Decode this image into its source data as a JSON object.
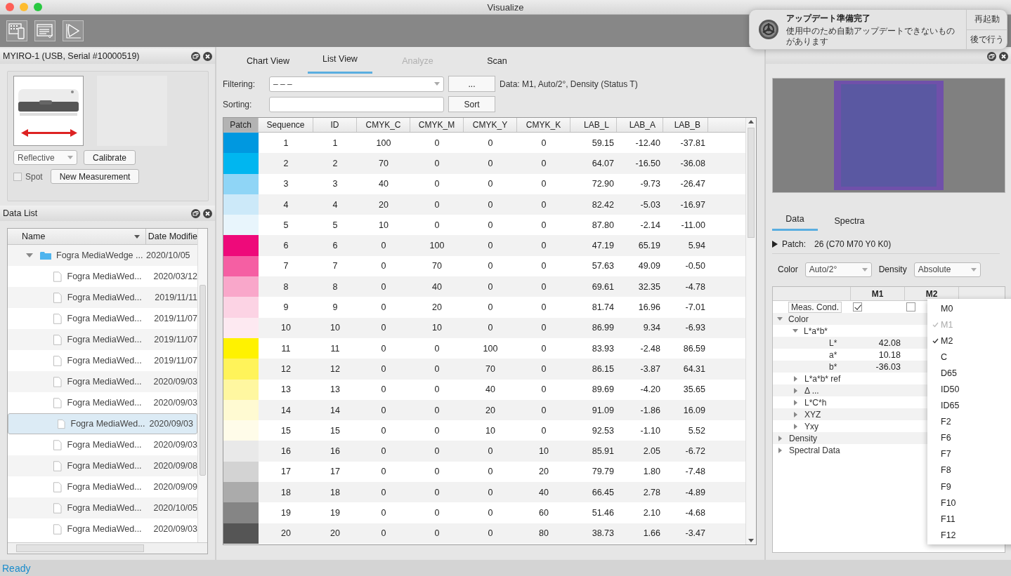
{
  "window": {
    "title": "Visualize"
  },
  "device_panel": {
    "title": "MYIRO-1 (USB, Serial #10000519)",
    "mode": "Reflective",
    "calibrate": "Calibrate",
    "spot": {
      "label": "Spot",
      "checked": false
    },
    "new_measurement": "New Measurement"
  },
  "data_list": {
    "title": "Data List",
    "columns": [
      "Name",
      "Date Modifie"
    ],
    "folder": {
      "name": "Fogra MediaWedge ...",
      "date": "2020/10/05",
      "expanded": true,
      "children": [
        {
          "name": "Fogra MediaWed...",
          "date": "2020/03/12",
          "selected": false
        },
        {
          "name": "Fogra MediaWed...",
          "date": "2019/11/11",
          "selected": false
        },
        {
          "name": "Fogra MediaWed...",
          "date": "2019/11/07",
          "selected": false
        },
        {
          "name": "Fogra MediaWed...",
          "date": "2019/11/07",
          "selected": false
        },
        {
          "name": "Fogra MediaWed...",
          "date": "2019/11/07",
          "selected": false
        },
        {
          "name": "Fogra MediaWed...",
          "date": "2020/09/03",
          "selected": false
        },
        {
          "name": "Fogra MediaWed...",
          "date": "2020/09/03",
          "selected": false
        },
        {
          "name": "Fogra MediaWed...",
          "date": "2020/09/03",
          "selected": true
        },
        {
          "name": "Fogra MediaWed...",
          "date": "2020/09/03",
          "selected": false
        },
        {
          "name": "Fogra MediaWed...",
          "date": "2020/09/08",
          "selected": false
        },
        {
          "name": "Fogra MediaWed...",
          "date": "2020/09/09",
          "selected": false
        },
        {
          "name": "Fogra MediaWed...",
          "date": "2020/10/05",
          "selected": false
        },
        {
          "name": "Fogra MediaWed...",
          "date": "2020/09/03",
          "selected": false
        }
      ]
    }
  },
  "view_tabs": [
    {
      "label": "Chart View",
      "selected": false,
      "disabled": false
    },
    {
      "label": "List View",
      "selected": true,
      "disabled": false
    },
    {
      "label": "Analyze",
      "selected": false,
      "disabled": true
    },
    {
      "label": "Scan",
      "selected": false,
      "disabled": false
    }
  ],
  "filtering": {
    "label": "Filtering:",
    "value": "– – –",
    "button": "...",
    "info": "Data: M1, Auto/2°, Density (Status T)"
  },
  "sorting": {
    "label": "Sorting:",
    "button": "Sort"
  },
  "table": {
    "columns": [
      "Patch",
      "Sequence",
      "ID",
      "CMYK_C",
      "CMYK_M",
      "CMYK_Y",
      "CMYK_K",
      "LAB_L",
      "LAB_A",
      "LAB_B"
    ],
    "rows": [
      {
        "color": "#0098e0",
        "cells": [
          "",
          "1",
          "1",
          "100",
          "0",
          "0",
          "0",
          "59.15",
          "-12.40",
          "-37.81"
        ]
      },
      {
        "color": "#00b6f0",
        "cells": [
          "",
          "2",
          "2",
          "70",
          "0",
          "0",
          "0",
          "64.07",
          "-16.50",
          "-36.08"
        ]
      },
      {
        "color": "#8fd5f6",
        "cells": [
          "",
          "3",
          "3",
          "40",
          "0",
          "0",
          "0",
          "72.90",
          "-9.73",
          "-26.47"
        ]
      },
      {
        "color": "#cce9f9",
        "cells": [
          "",
          "4",
          "4",
          "20",
          "0",
          "0",
          "0",
          "82.42",
          "-5.03",
          "-16.97"
        ]
      },
      {
        "color": "#e8f5fc",
        "cells": [
          "",
          "5",
          "5",
          "10",
          "0",
          "0",
          "0",
          "87.80",
          "-2.14",
          "-11.00"
        ]
      },
      {
        "color": "#ee0a7a",
        "cells": [
          "",
          "6",
          "6",
          "0",
          "100",
          "0",
          "0",
          "47.19",
          "65.19",
          "5.94"
        ]
      },
      {
        "color": "#f55fa3",
        "cells": [
          "",
          "7",
          "7",
          "0",
          "70",
          "0",
          "0",
          "57.63",
          "49.09",
          "-0.50"
        ]
      },
      {
        "color": "#f9a7ca",
        "cells": [
          "",
          "8",
          "8",
          "0",
          "40",
          "0",
          "0",
          "69.61",
          "32.35",
          "-4.78"
        ]
      },
      {
        "color": "#fcd3e4",
        "cells": [
          "",
          "9",
          "9",
          "0",
          "20",
          "0",
          "0",
          "81.74",
          "16.96",
          "-7.01"
        ]
      },
      {
        "color": "#fde9f1",
        "cells": [
          "",
          "10",
          "10",
          "0",
          "10",
          "0",
          "0",
          "86.99",
          "9.34",
          "-6.93"
        ]
      },
      {
        "color": "#fff200",
        "cells": [
          "",
          "11",
          "11",
          "0",
          "0",
          "100",
          "0",
          "83.93",
          "-2.48",
          "86.59"
        ]
      },
      {
        "color": "#fff35a",
        "cells": [
          "",
          "12",
          "12",
          "0",
          "0",
          "70",
          "0",
          "86.15",
          "-3.87",
          "64.31"
        ]
      },
      {
        "color": "#fff7a0",
        "cells": [
          "",
          "13",
          "13",
          "0",
          "0",
          "40",
          "0",
          "89.69",
          "-4.20",
          "35.65"
        ]
      },
      {
        "color": "#fffad2",
        "cells": [
          "",
          "14",
          "14",
          "0",
          "0",
          "20",
          "0",
          "91.09",
          "-1.86",
          "16.09"
        ]
      },
      {
        "color": "#fffce9",
        "cells": [
          "",
          "15",
          "15",
          "0",
          "0",
          "10",
          "0",
          "92.53",
          "-1.10",
          "5.52"
        ]
      },
      {
        "color": "#e9e9e9",
        "cells": [
          "",
          "16",
          "16",
          "0",
          "0",
          "0",
          "10",
          "85.91",
          "2.05",
          "-6.72"
        ]
      },
      {
        "color": "#d3d3d3",
        "cells": [
          "",
          "17",
          "17",
          "0",
          "0",
          "0",
          "20",
          "79.79",
          "1.80",
          "-7.48"
        ]
      },
      {
        "color": "#ababab",
        "cells": [
          "",
          "18",
          "18",
          "0",
          "0",
          "0",
          "40",
          "66.45",
          "2.78",
          "-4.89"
        ]
      },
      {
        "color": "#858585",
        "cells": [
          "",
          "19",
          "19",
          "0",
          "0",
          "0",
          "60",
          "51.46",
          "2.10",
          "-4.68"
        ]
      },
      {
        "color": "#555555",
        "cells": [
          "",
          "20",
          "20",
          "0",
          "0",
          "0",
          "80",
          "38.73",
          "1.66",
          "-3.47"
        ]
      }
    ]
  },
  "detail_tabs": [
    {
      "label": "Data",
      "selected": true
    },
    {
      "label": "Spectra",
      "selected": false
    }
  ],
  "patch": {
    "label": "Patch:",
    "value": "26 (C70 M70 Y0 K0)"
  },
  "color_select": {
    "label": "Color",
    "value": "Auto/2°"
  },
  "density_select": {
    "label": "Density",
    "value": "Absolute"
  },
  "measurements": {
    "columns": [
      "M1",
      "M2"
    ],
    "rows": [
      {
        "kind": "condition",
        "label": "Meas. Cond.",
        "checks": [
          true,
          false
        ]
      },
      {
        "kind": "group",
        "label": "Color",
        "expanded": true,
        "children": [
          {
            "kind": "group",
            "label": "L*a*b*",
            "expanded": true,
            "children": [
              {
                "kind": "value",
                "label": "L*",
                "values": [
                  "42.08"
                ]
              },
              {
                "kind": "value",
                "label": "a*",
                "values": [
                  "10.18"
                ]
              },
              {
                "kind": "value",
                "label": "b*",
                "values": [
                  "-36.03"
                ]
              }
            ]
          },
          {
            "kind": "group",
            "label": "L*a*b* ref",
            "expanded": false
          },
          {
            "kind": "group",
            "label": "Δ ...",
            "expanded": false
          },
          {
            "kind": "group",
            "label": "L*C*h",
            "expanded": false
          },
          {
            "kind": "group",
            "label": "XYZ",
            "expanded": false
          },
          {
            "kind": "group",
            "label": "Yxy",
            "expanded": false
          }
        ]
      },
      {
        "kind": "group",
        "label": "Density",
        "expanded": false
      },
      {
        "kind": "group",
        "label": "Spectral Data",
        "expanded": false
      }
    ]
  },
  "condition_menu": {
    "items": [
      {
        "label": "M0",
        "checked": false,
        "disabled": false
      },
      {
        "label": "M1",
        "checked": true,
        "disabled": true
      },
      {
        "label": "M2",
        "checked": true,
        "disabled": false
      },
      {
        "label": "C",
        "checked": false,
        "disabled": false
      },
      {
        "label": "D65",
        "checked": false,
        "disabled": false
      },
      {
        "label": "ID50",
        "checked": false,
        "disabled": false
      },
      {
        "label": "ID65",
        "checked": false,
        "disabled": false
      },
      {
        "label": "F2",
        "checked": false,
        "disabled": false
      },
      {
        "label": "F6",
        "checked": false,
        "disabled": false
      },
      {
        "label": "F7",
        "checked": false,
        "disabled": false
      },
      {
        "label": "F8",
        "checked": false,
        "disabled": false
      },
      {
        "label": "F9",
        "checked": false,
        "disabled": false
      },
      {
        "label": "F10",
        "checked": false,
        "disabled": false
      },
      {
        "label": "F11",
        "checked": false,
        "disabled": false
      },
      {
        "label": "F12",
        "checked": false,
        "disabled": false
      }
    ]
  },
  "notification": {
    "title": "アップデート準備完了",
    "message": "使用中のため自動アップデートできないものがあります",
    "buttons": [
      "再起動",
      "後で行う"
    ]
  },
  "status_bar": {
    "text": "Ready"
  }
}
